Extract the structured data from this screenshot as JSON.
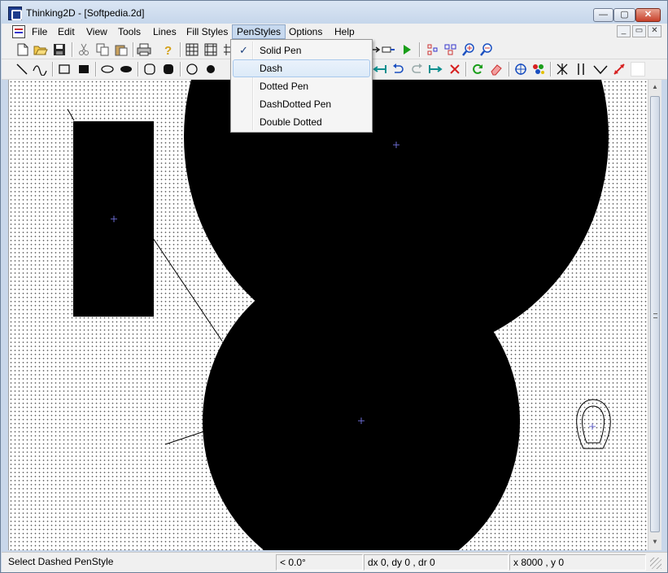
{
  "window": {
    "title": "Thinking2D - [Softpedia.2d]",
    "controls": {
      "minimize": "—",
      "maximize": "▢",
      "close": "✕"
    }
  },
  "menu": {
    "items": [
      "File",
      "Edit",
      "View",
      "Tools",
      "Lines",
      "Fill Styles",
      "PenStyles",
      "Options",
      "Help"
    ],
    "active": "PenStyles",
    "mdi_controls": [
      "_",
      "▭",
      "✕"
    ]
  },
  "dropdown": {
    "items": [
      {
        "label": "Solid Pen",
        "checked": true,
        "hover": false
      },
      {
        "label": "Dash",
        "checked": false,
        "hover": true
      },
      {
        "label": "Dotted Pen",
        "checked": false,
        "hover": false
      },
      {
        "label": "DashDotted Pen",
        "checked": false,
        "hover": false
      },
      {
        "label": "Double Dotted",
        "checked": false,
        "hover": false
      }
    ],
    "check_glyph": "✓"
  },
  "toolbar1": {
    "icons": [
      "new-icon",
      "open-icon",
      "save-icon",
      "cut-icon",
      "copy-icon",
      "paste-icon",
      "print-icon",
      "help-icon",
      "grid-icon",
      "grid-snap-icon",
      "hash-icon",
      "arrow-icon",
      "run-icon",
      "distribute-icon",
      "align-icon",
      "zoom-in-icon",
      "zoom-out-icon"
    ]
  },
  "toolbar2": {
    "icons": [
      "line-icon",
      "curve-icon",
      "rectangle-icon",
      "filled-rectangle-icon",
      "ellipse-icon",
      "filled-ellipse-icon",
      "rounded-rect-icon",
      "filled-rounded-rect-icon",
      "circle-icon",
      "filled-circle-icon",
      "stretch-left-icon",
      "undo-icon",
      "redo-icon",
      "stretch-right-icon",
      "delete-icon",
      "refresh-icon",
      "eraser-icon",
      "target-icon",
      "color-icon",
      "symmetry-icon",
      "parallel-icon",
      "angle-icon",
      "perpendicular-icon"
    ]
  },
  "canvas": {
    "background": "dotted grid"
  },
  "status": {
    "message": "Select Dashed PenStyle",
    "angle": "< 0.0°",
    "delta": "dx 0, dy 0 , dr 0",
    "coords": "x 8000 , y 0"
  },
  "colors": {
    "title_bg": "#c4d5ea",
    "menu_bg": "#f0f0f0",
    "shape_fill": "#000000",
    "center_mark": "#6a6ad0",
    "play_green": "#1a9e1a",
    "zoom_blue": "#1a4fc0"
  }
}
